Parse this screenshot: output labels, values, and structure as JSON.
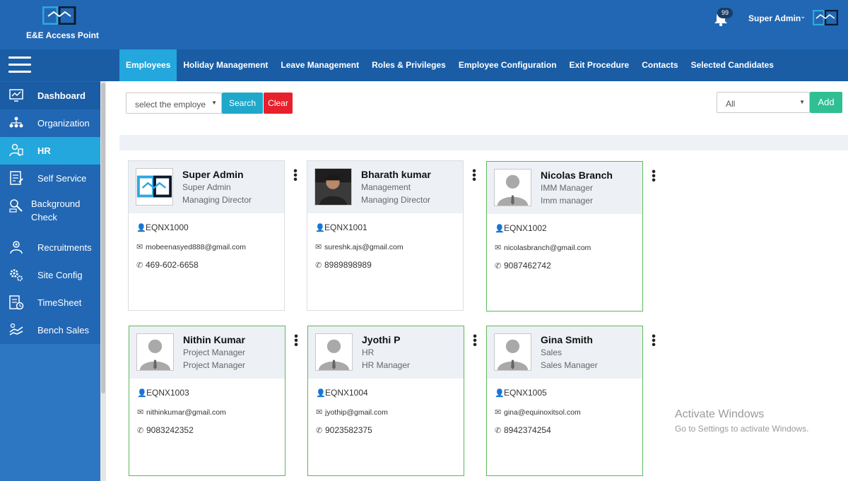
{
  "header": {
    "brand": "E&E Access Point",
    "notification_count": "99",
    "user_name": "Super Admin"
  },
  "nav": {
    "tabs": [
      {
        "label": "Employees",
        "active": true
      },
      {
        "label": "Holiday Management"
      },
      {
        "label": "Leave Management"
      },
      {
        "label": "Roles & Privileges"
      },
      {
        "label": "Employee Configuration"
      },
      {
        "label": "Exit Procedure"
      },
      {
        "label": "Contacts"
      },
      {
        "label": "Selected Candidates"
      }
    ]
  },
  "sidebar": {
    "items": [
      {
        "label": "Dashboard",
        "icon": "dashboard-icon"
      },
      {
        "label": "Organization",
        "icon": "organization-icon"
      },
      {
        "label": "HR",
        "icon": "hr-icon",
        "active": true
      },
      {
        "label": "Self Service",
        "icon": "self-service-icon"
      },
      {
        "label": "Background Check",
        "icon": "background-check-icon"
      },
      {
        "label": "Recruitments",
        "icon": "recruitments-icon"
      },
      {
        "label": "Site Config",
        "icon": "site-config-icon"
      },
      {
        "label": "TimeSheet",
        "icon": "timesheet-icon"
      },
      {
        "label": "Bench Sales",
        "icon": "bench-sales-icon"
      }
    ]
  },
  "toolbar": {
    "employee_select": "select the employe",
    "search_label": "Search",
    "clear_label": "Clear",
    "filter_select": "All",
    "add_label": "Add"
  },
  "employees": [
    {
      "name": "Super Admin",
      "dept": "Super Admin",
      "role": "Managing Director",
      "id": "EQNX1000",
      "email": "mobeenasyed888@gmail.com",
      "phone": "469-602-6658",
      "avatar": "logo"
    },
    {
      "name": "Bharath kumar",
      "dept": "Management",
      "role": "Managing Director",
      "id": "EQNX1001",
      "email": "sureshk.ajs@gmail.com",
      "phone": "8989898989",
      "avatar": "photo"
    },
    {
      "name": "Nicolas Branch",
      "dept": "IMM Manager",
      "role": "Imm manager",
      "id": "EQNX1002",
      "email": "nicolasbranch@gmail.com",
      "phone": "9087462742",
      "avatar": "placeholder"
    },
    {
      "name": "Nithin Kumar",
      "dept": "Project Manager",
      "role": "Project Manager",
      "id": "EQNX1003",
      "email": "nithinkumar@gmail.com",
      "phone": "9083242352",
      "avatar": "placeholder"
    },
    {
      "name": "Jyothi P",
      "dept": "HR",
      "role": "HR Manager",
      "id": "EQNX1004",
      "email": "jyothip@gmail.com",
      "phone": "9023582375",
      "avatar": "placeholder"
    },
    {
      "name": "Gina Smith",
      "dept": "Sales",
      "role": "Sales Manager",
      "id": "EQNX1005",
      "email": "gina@equinoxitsol.com",
      "phone": "8942374254",
      "avatar": "placeholder"
    }
  ],
  "watermark": {
    "title": "Activate Windows",
    "subtitle": "Go to Settings to activate Windows."
  }
}
